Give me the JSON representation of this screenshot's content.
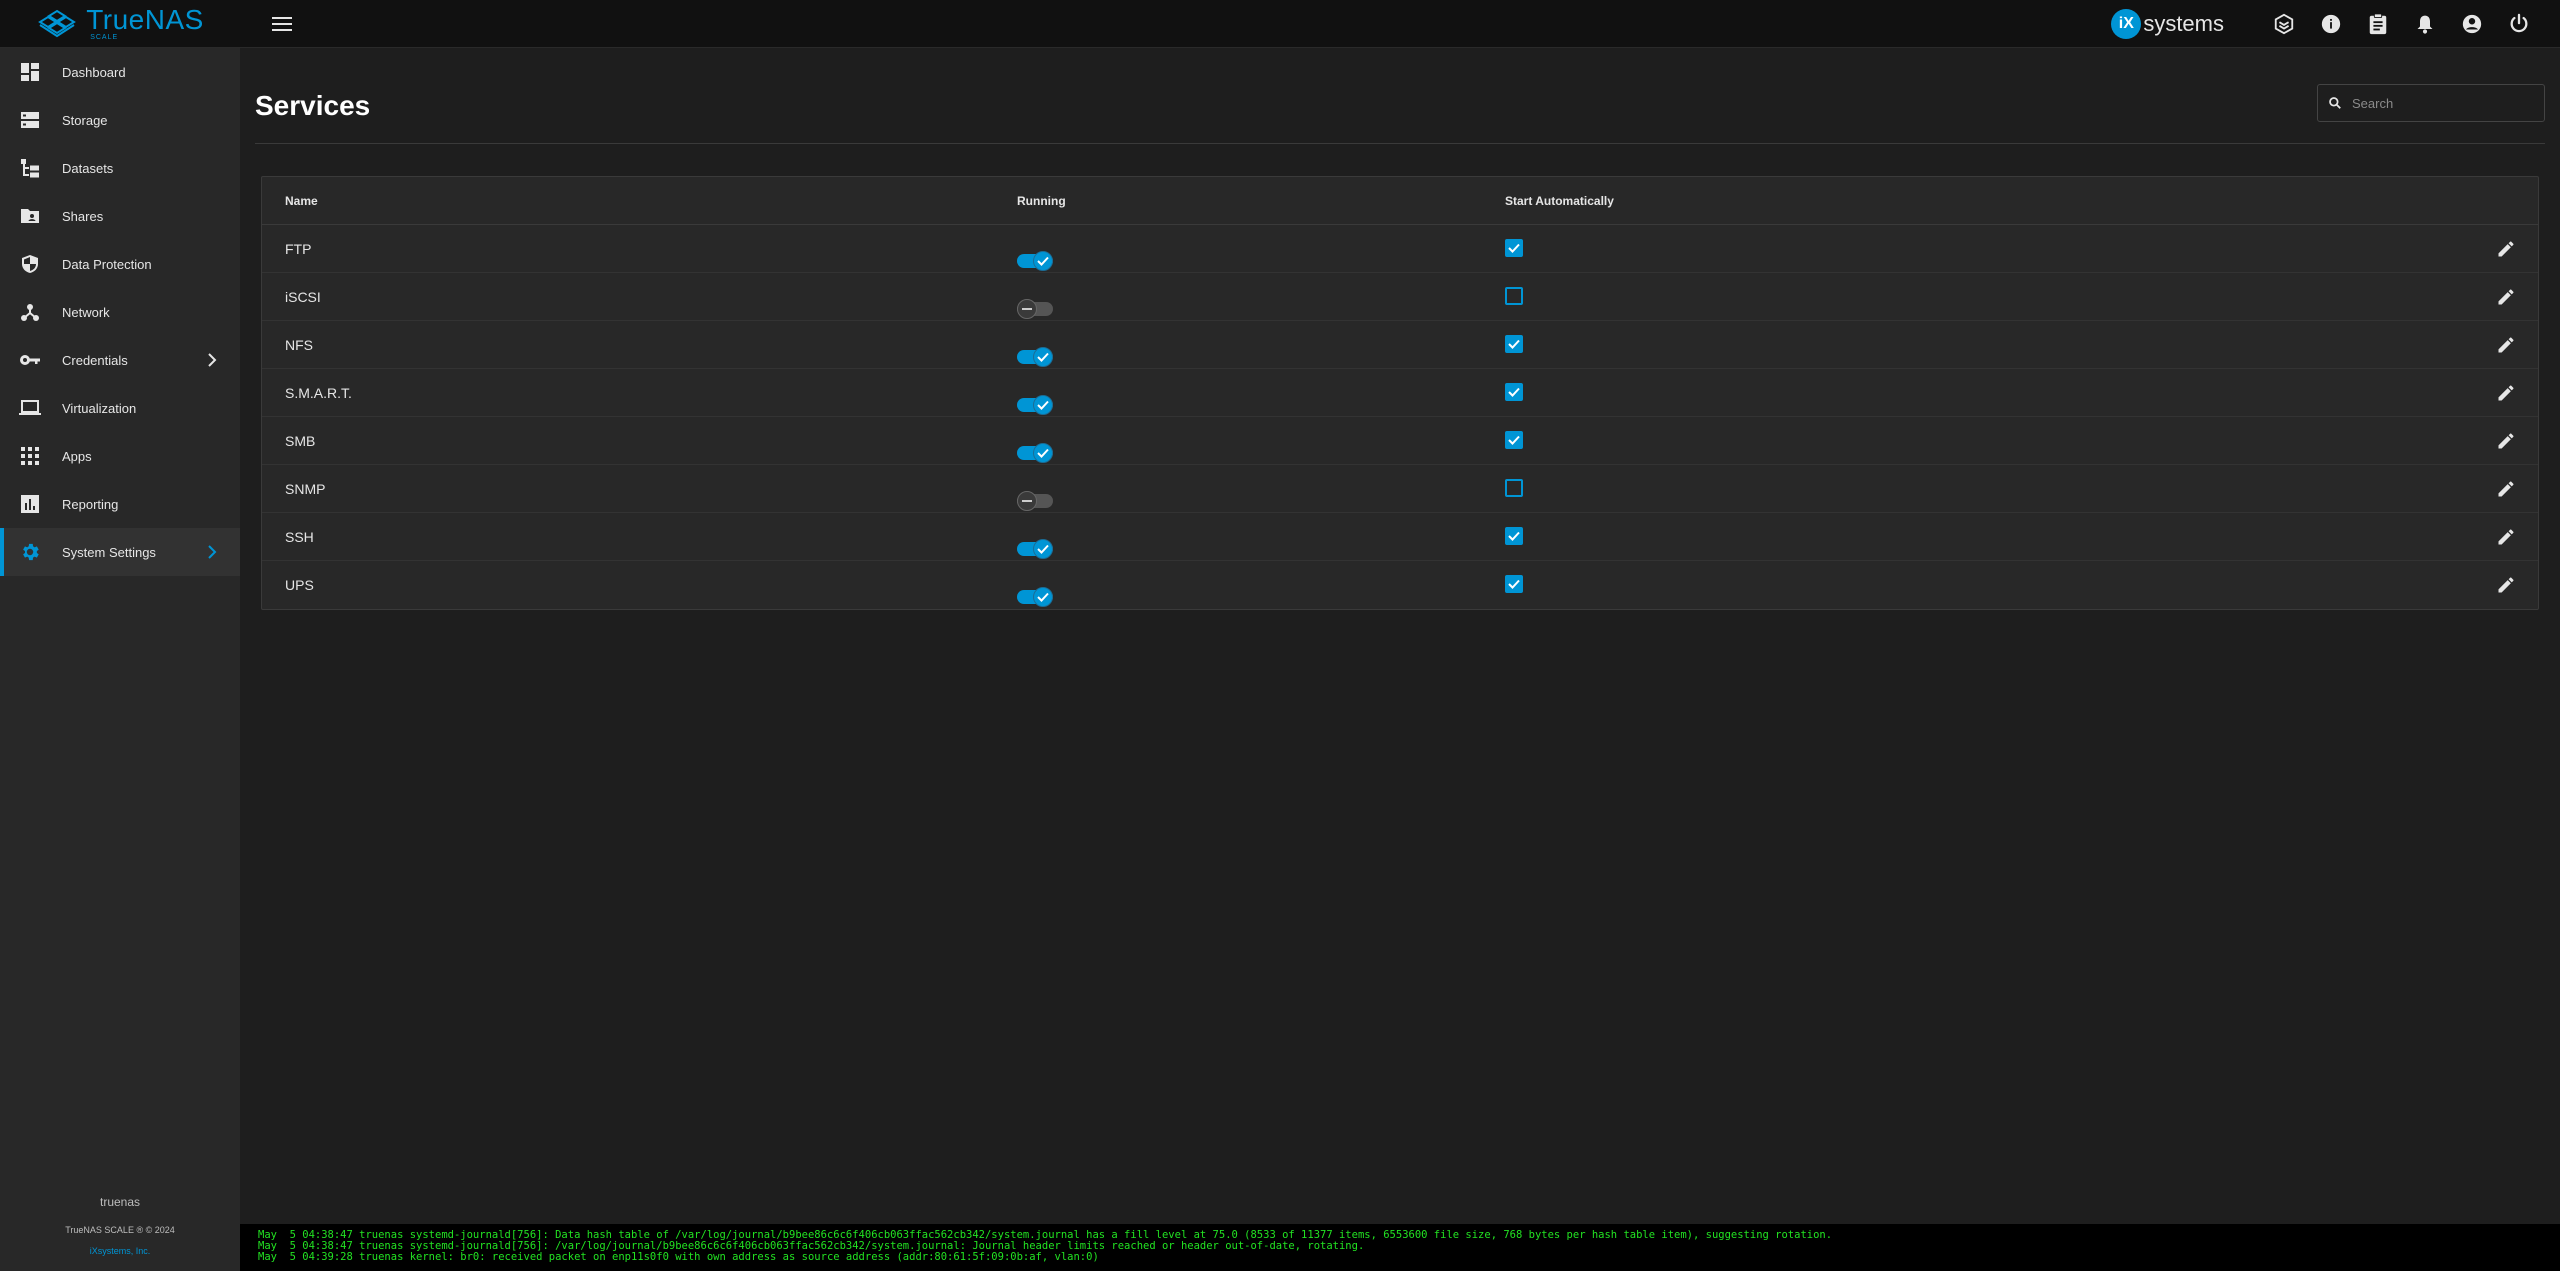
{
  "app": {
    "brand_name": "TrueNAS",
    "brand_sub": "SCALE",
    "vendor": "systems",
    "vendor_initials": "iX",
    "accent_color": "#0095d5"
  },
  "topbar": {
    "icons": [
      "truecommand-icon",
      "info-icon",
      "clipboard-icon",
      "bell-icon",
      "account-icon",
      "power-icon"
    ]
  },
  "sidebar": {
    "items": [
      {
        "label": "Dashboard",
        "icon": "dashboard-icon"
      },
      {
        "label": "Storage",
        "icon": "storage-icon"
      },
      {
        "label": "Datasets",
        "icon": "datasets-icon"
      },
      {
        "label": "Shares",
        "icon": "shares-icon"
      },
      {
        "label": "Data Protection",
        "icon": "shield-icon"
      },
      {
        "label": "Network",
        "icon": "network-icon"
      },
      {
        "label": "Credentials",
        "icon": "key-icon",
        "has_submenu": true
      },
      {
        "label": "Virtualization",
        "icon": "laptop-icon"
      },
      {
        "label": "Apps",
        "icon": "apps-icon"
      },
      {
        "label": "Reporting",
        "icon": "reporting-icon"
      },
      {
        "label": "System Settings",
        "icon": "gear-icon",
        "has_submenu": true,
        "active": true
      }
    ],
    "footer": {
      "hostname": "truenas",
      "copyright": "TrueNAS SCALE ® © 2024",
      "company": "iXsystems, Inc."
    }
  },
  "page": {
    "title": "Services",
    "search_placeholder": "Search"
  },
  "table": {
    "headers": {
      "name": "Name",
      "running": "Running",
      "auto": "Start Automatically"
    },
    "rows": [
      {
        "name": "FTP",
        "running": true,
        "auto": true
      },
      {
        "name": "iSCSI",
        "running": false,
        "auto": false
      },
      {
        "name": "NFS",
        "running": true,
        "auto": true
      },
      {
        "name": "S.M.A.R.T.",
        "running": true,
        "auto": true
      },
      {
        "name": "SMB",
        "running": true,
        "auto": true
      },
      {
        "name": "SNMP",
        "running": false,
        "auto": false
      },
      {
        "name": "SSH",
        "running": true,
        "auto": true
      },
      {
        "name": "UPS",
        "running": true,
        "auto": true
      }
    ]
  },
  "console": {
    "lines": [
      "May  5 04:38:47 truenas systemd-journald[756]: Data hash table of /var/log/journal/b9bee86c6c6f406cb063ffac562cb342/system.journal has a fill level at 75.0 (8533 of 11377 items, 6553600 file size, 768 bytes per hash table item), suggesting rotation.",
      "May  5 04:38:47 truenas systemd-journald[756]: /var/log/journal/b9bee86c6c6f406cb063ffac562cb342/system.journal: Journal header limits reached or header out-of-date, rotating.",
      "May  5 04:39:28 truenas kernel: br0: received packet on enp11s0f0 with own address as source address (addr:80:61:5f:09:0b:af, vlan:0)"
    ]
  }
}
